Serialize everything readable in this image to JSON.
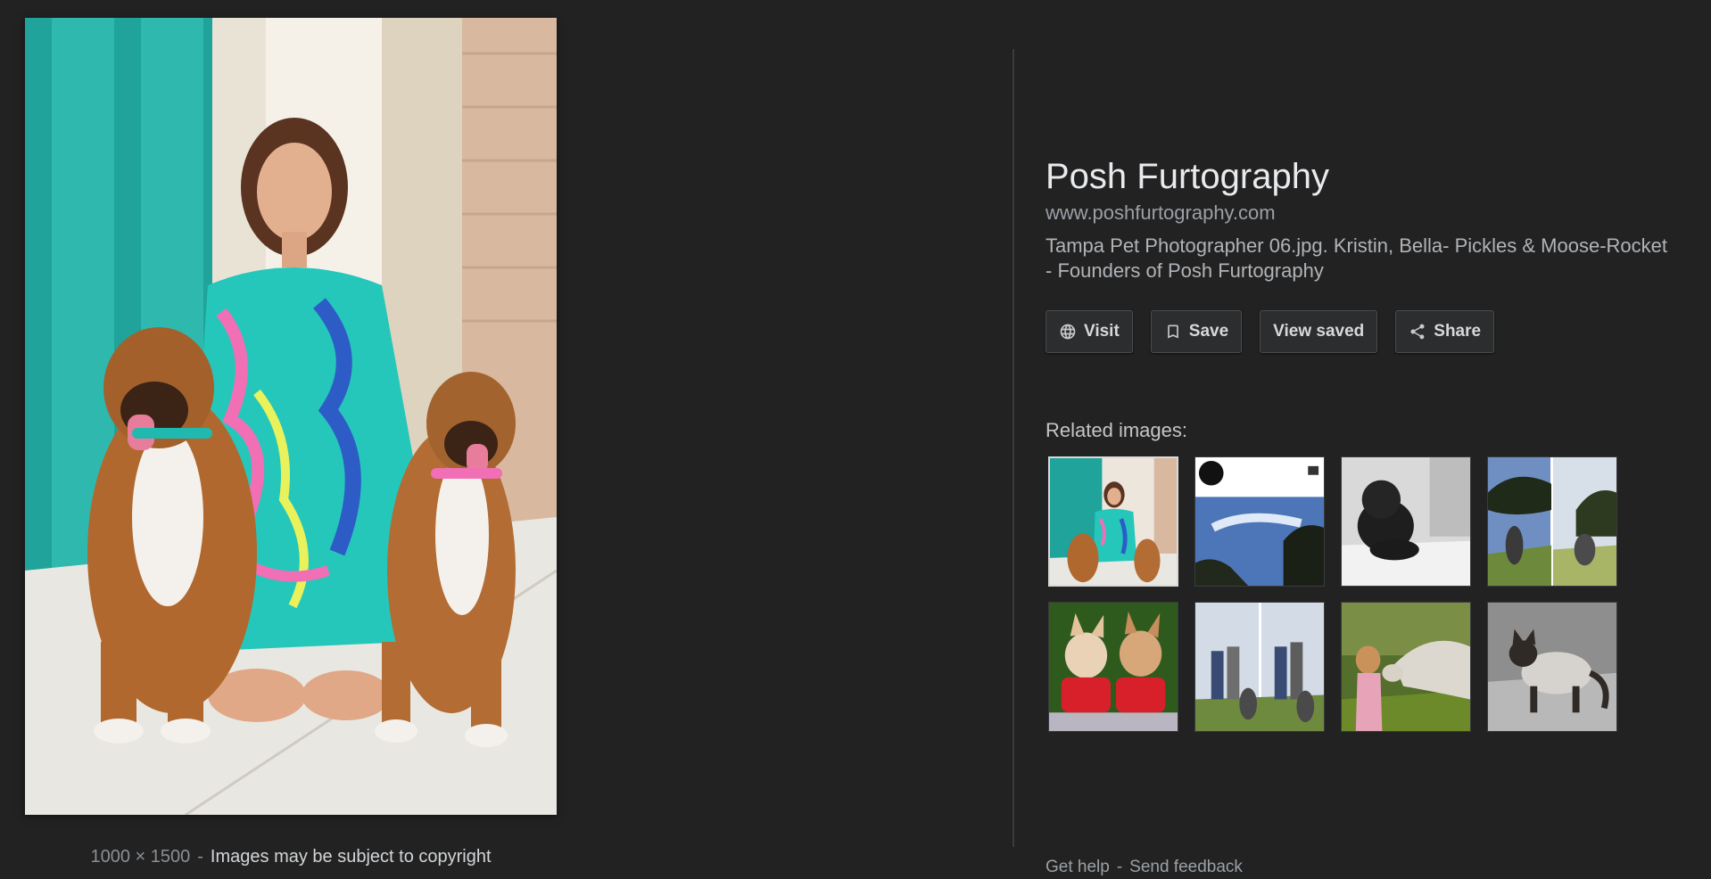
{
  "image": {
    "alt": "",
    "dimensions": "1000 × 1500",
    "separator": "-",
    "copyright_notice": "Images may be subject to copyright"
  },
  "details": {
    "title": "Posh Furtography",
    "site": "www.poshfurtography.com",
    "description": "Tampa Pet Photographer 06.jpg. Kristin, Bella- Pickles & Moose-Rocket - Founders of Posh Furtography"
  },
  "actions": {
    "visit": {
      "label": "Visit",
      "icon": "globe-icon"
    },
    "save": {
      "label": "Save",
      "icon": "bookmark-icon"
    },
    "view_saved": {
      "label": "View saved"
    },
    "share": {
      "label": "Share",
      "icon": "share-icon"
    }
  },
  "related": {
    "heading": "Related images:",
    "thumbnails": [
      {
        "name": "related-thumb-1"
      },
      {
        "name": "related-thumb-2"
      },
      {
        "name": "related-thumb-3"
      },
      {
        "name": "related-thumb-4"
      },
      {
        "name": "related-thumb-5"
      },
      {
        "name": "related-thumb-6"
      },
      {
        "name": "related-thumb-7"
      },
      {
        "name": "related-thumb-8"
      }
    ]
  },
  "footer": {
    "get_help": "Get help",
    "separator": "-",
    "send_feedback": "Send feedback"
  },
  "colors": {
    "background": "#222222",
    "divider": "#3a3b3d",
    "button_bg": "#2c2d2f",
    "text_primary": "#e8eaed",
    "text_secondary": "#9aa0a6"
  }
}
